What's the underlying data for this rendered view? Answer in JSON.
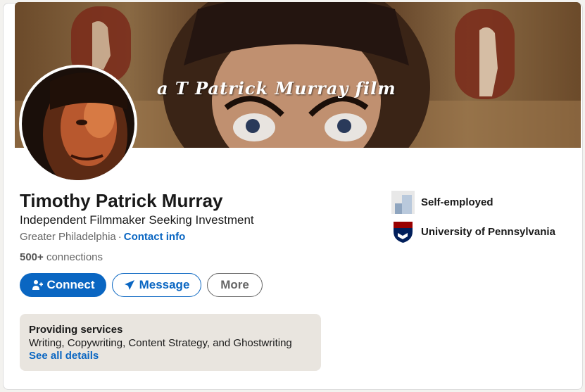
{
  "banner": {
    "text": "a T Patrick Murray film"
  },
  "profile": {
    "name": "Timothy Patrick Murray",
    "headline": "Independent Filmmaker Seeking Investment",
    "location": "Greater Philadelphia",
    "separator": "·",
    "contact_info": "Contact info",
    "connections_count": "500+",
    "connections_label": "connections"
  },
  "actions": {
    "connect": "Connect",
    "message": "Message",
    "more": "More"
  },
  "services": {
    "title": "Providing services",
    "list": "Writing, Copywriting, Content Strategy, and Ghostwriting",
    "link": "See all details"
  },
  "experience": [
    {
      "name": "Self-employed",
      "icon": "company-placeholder-icon"
    },
    {
      "name": "University of Pennsylvania",
      "icon": "penn-shield-icon"
    }
  ],
  "colors": {
    "accent": "#0a66c2",
    "card_bg": "#ffffff",
    "services_bg": "#e9e5df"
  }
}
